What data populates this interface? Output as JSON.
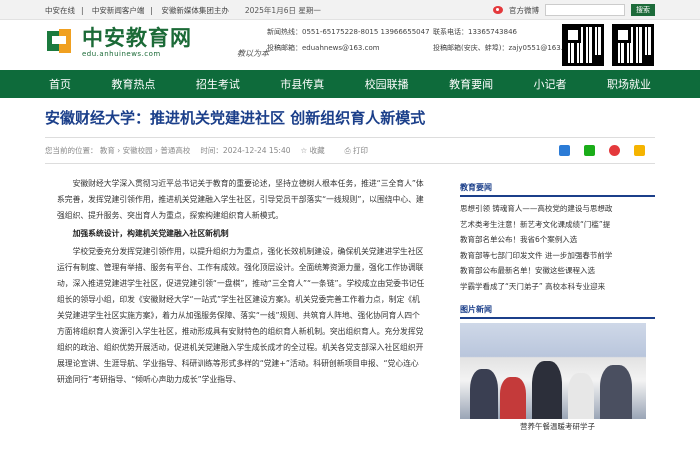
{
  "topbar": {
    "links": [
      "中安在线",
      "中安新闻客户端",
      "安徽新媒体集团主办"
    ],
    "date": "2025年1月6日 星期一",
    "weibo": "官方微博",
    "search_btn": "搜索"
  },
  "header": {
    "logo_cn": "中安教育网",
    "logo_url": "edu.anhuinews.com",
    "signature": "教以为本",
    "contacts_left": [
      "新闻热线：0551-65175228-8015 13966655047",
      "投稿邮箱：eduahnews@163.com"
    ],
    "contacts_right": [
      "联系电话：13365743846",
      "投稿邮箱(安庆、蚌埠)：zajy0551@163.com"
    ]
  },
  "nav": [
    "首页",
    "教育热点",
    "招生考试",
    "市县传真",
    "校园联播",
    "教育要闻",
    "小记者",
    "职场就业"
  ],
  "article": {
    "title": "安徽财经大学：推进机关党建进社区 创新组织育人新模式",
    "breadcrumb": "您当前的位置：  教育 › 安徽校园 › 普通高校",
    "time": "时间：2024-12-24 15:40",
    "fav": "收藏",
    "print": "打印",
    "paragraphs": [
      "安徽财经大学深入贯彻习近平总书记关于教育的重要论述，坚持立德树人根本任务，推进“三全育人”体系完善，发挥党建引领作用，推进机关党建融入学生社区，引导党员干部落实“一线规则”，以围绕中心、建强组织、提升服务、突出育人为重点，探索构建组织育人新模式。",
      "加强系统设计，构建机关党建融入社区新机制",
      "学校党委充分发挥党建引领作用，以提升组织力为重点，强化长效机制建设，确保机关党建进学生社区运行有制度、管理有举措、服务有平台、工作有成效。强化顶层设计。全面统筹资源力量，强化工作协调联动，深入推进党建进学生社区，促进党建引领“一盘棋”，推动“三全育人”“一条链”。学校成立由党委书记任组长的领导小组，印发《安徽财经大学“一站式”学生社区建设方案》。机关党委完善工作着力点，制定《机关党建进学生社区实施方案》，着力从加强服务保障、落实“一线”规则、共筑育人阵地、强化协同育人四个方面将组织育人资源引入学生社区，推动形成具有安财特色的组织育人新机制。突出组织育人。充分发挥党组织的政治、组织优势开展活动，促进机关党建融入学生成长成才的全过程。机关各党支部深入社区组织开展理论宣讲、生涯导航、学业指导、科研训练等形式多样的“党建+”活动。科研创新项目申报、“党心连心研途同行”考研指导、“倾听心声助力成长”学业指导、"
    ]
  },
  "sidebar": {
    "news_title": "教育要闻",
    "news": [
      "思想引领 铸魂育人——高校党的建设与思想政",
      "艺术类考生注意！新艺考文化课成绩“门槛”提",
      "教育部名单公布！我省6个案例入选",
      "教育部等七部门印发文件 进一步加强春节前学",
      "教育部公布最新名单！安徽这些课程入选",
      "学霸学看成了“天门弟子” 高校本科专业迎来"
    ],
    "photo_title": "图片新闻",
    "photo_caption": "营养午餐温暖考研学子"
  },
  "colors": {
    "brand_green": "#0e6b3b",
    "title_blue": "#1b3f8a",
    "logo_orange": "#f0a020"
  }
}
